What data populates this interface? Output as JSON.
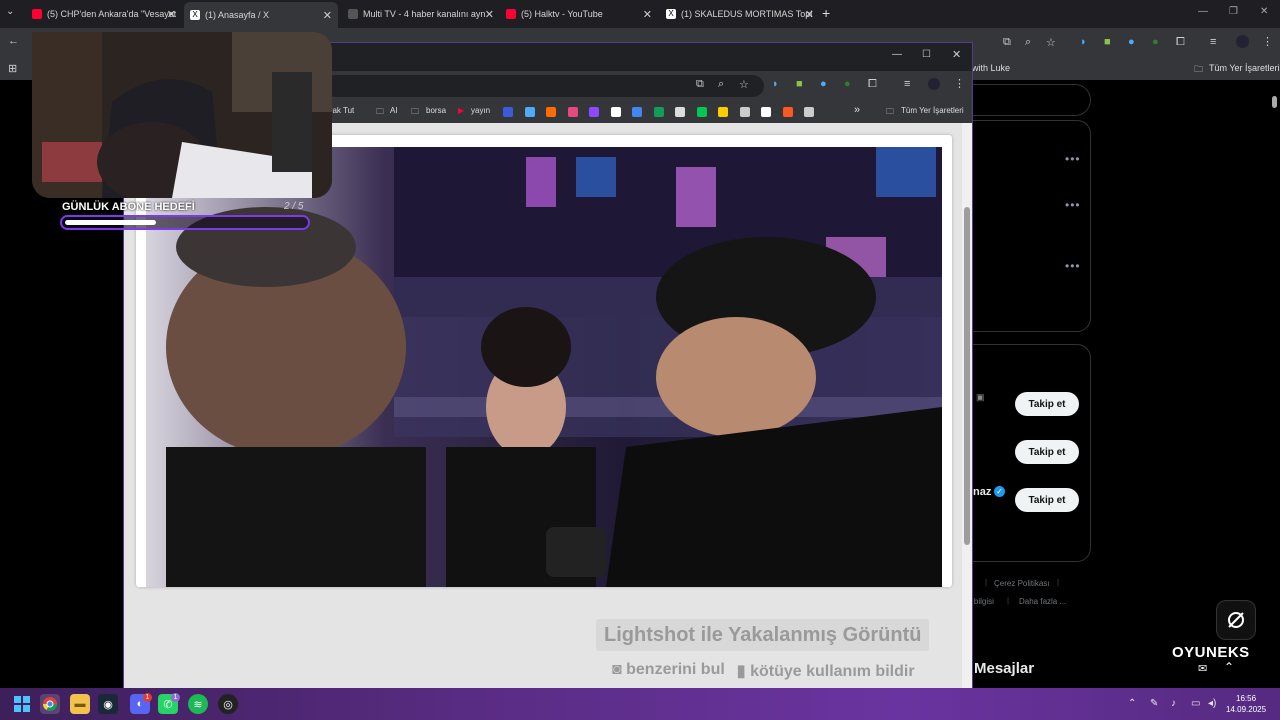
{
  "outer_tabs": [
    {
      "label": "(5) CHP'den Ankara'da \"Vesayet",
      "color": "#ff0033"
    },
    {
      "label": "(1) Anasayfa / X",
      "color": "#ffffff"
    },
    {
      "label": "Multi TV - 4 haber kanalını ayn",
      "color": "#555555"
    },
    {
      "label": "(5) Halktv - YouTube",
      "color": "#ff0033"
    },
    {
      "label": "(1) SKALEDUS MORTIMAS Topl",
      "color": "#ffffff"
    }
  ],
  "outer_bookmarks": {
    "partial_item": "with Luke",
    "all_bookmarks": "Tüm Yer İşaretleri"
  },
  "inner_bookmarks": {
    "items": [
      {
        "label": "Burak Tut",
        "color": "#888888"
      },
      {
        "label": "AI",
        "color": "#cccccc"
      },
      {
        "label": "borsa",
        "color": "#cccccc"
      },
      {
        "label": "yayın",
        "color": "#ff0033"
      }
    ],
    "icon_colors": [
      "#3b5bdb",
      "#4dabf7",
      "#ff6b00",
      "#e64980",
      "#9146ff",
      "#ffffff",
      "#4285f4",
      "#0f9d58",
      "#dddddd",
      "#00c853",
      "#ffcc00",
      "#cccccc",
      "#ffffff",
      "#ff5722",
      "#cccccc"
    ],
    "overflow": "»",
    "all_bookmarks": "Tüm Yer İşaretleri"
  },
  "x_page": {
    "follow_label": "Takip et",
    "name_partial": "naz",
    "footer": [
      "Çerez Politikası",
      "m bilgisi",
      "Daha fazla ..."
    ],
    "messages": "Mesajlar"
  },
  "lightshot": {
    "title": "Lightshot ile Yakalanmış Görüntü",
    "find_similar": "benzerini bul",
    "report": "kötüye kullanım bildir"
  },
  "overlay": {
    "sub_goal_label": "GÜNLÜK ABONE HEDEFİ",
    "sub_goal_count": "2 / 5",
    "sub_goal_progress": 0.38,
    "brand": "OYUNEKS"
  },
  "taskbar": {
    "time": "16:56",
    "date": "14.09.2025",
    "discord_badge": "1",
    "whatsapp_badge": "1"
  }
}
